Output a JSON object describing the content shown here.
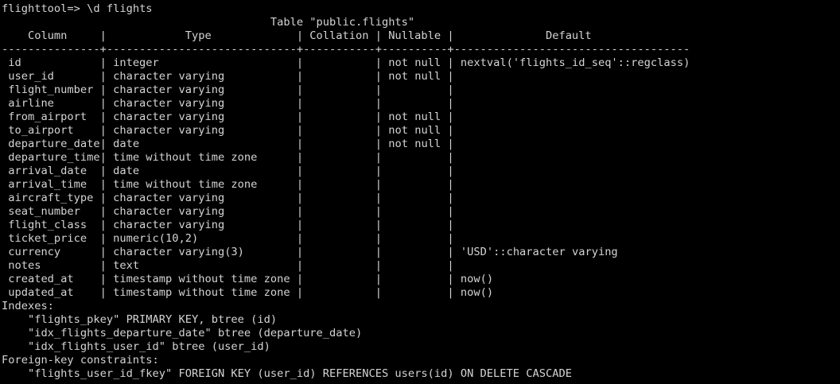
{
  "terminal": {
    "prompt": "flighttool=> ",
    "command": "\\d flights",
    "table_title": "Table \"public.flights\"",
    "headers": [
      "Column",
      "Type",
      "Collation",
      "Nullable",
      "Default"
    ],
    "rows": [
      [
        "id",
        "integer",
        "",
        "not null",
        "nextval('flights_id_seq'::regclass)"
      ],
      [
        "user_id",
        "character varying",
        "",
        "not null",
        ""
      ],
      [
        "flight_number",
        "character varying",
        "",
        "",
        ""
      ],
      [
        "airline",
        "character varying",
        "",
        "",
        ""
      ],
      [
        "from_airport",
        "character varying",
        "",
        "not null",
        ""
      ],
      [
        "to_airport",
        "character varying",
        "",
        "not null",
        ""
      ],
      [
        "departure_date",
        "date",
        "",
        "not null",
        ""
      ],
      [
        "departure_time",
        "time without time zone",
        "",
        "",
        ""
      ],
      [
        "arrival_date",
        "date",
        "",
        "",
        ""
      ],
      [
        "arrival_time",
        "time without time zone",
        "",
        "",
        ""
      ],
      [
        "aircraft_type",
        "character varying",
        "",
        "",
        ""
      ],
      [
        "seat_number",
        "character varying",
        "",
        "",
        ""
      ],
      [
        "flight_class",
        "character varying",
        "",
        "",
        ""
      ],
      [
        "ticket_price",
        "numeric(10,2)",
        "",
        "",
        ""
      ],
      [
        "currency",
        "character varying(3)",
        "",
        "",
        "'USD'::character varying"
      ],
      [
        "notes",
        "text",
        "",
        "",
        ""
      ],
      [
        "created_at",
        "timestamp without time zone",
        "",
        "",
        "now()"
      ],
      [
        "updated_at",
        "timestamp without time zone",
        "",
        "",
        "now()"
      ]
    ],
    "indexes_label": "Indexes:",
    "indexes": [
      "\"flights_pkey\" PRIMARY KEY, btree (id)",
      "\"idx_flights_departure_date\" btree (departure_date)",
      "\"idx_flights_user_id\" btree (user_id)"
    ],
    "fk_label": "Foreign-key constraints:",
    "foreign_keys": [
      "\"flights_user_id_fkey\" FOREIGN KEY (user_id) REFERENCES users(id) ON DELETE CASCADE"
    ]
  }
}
